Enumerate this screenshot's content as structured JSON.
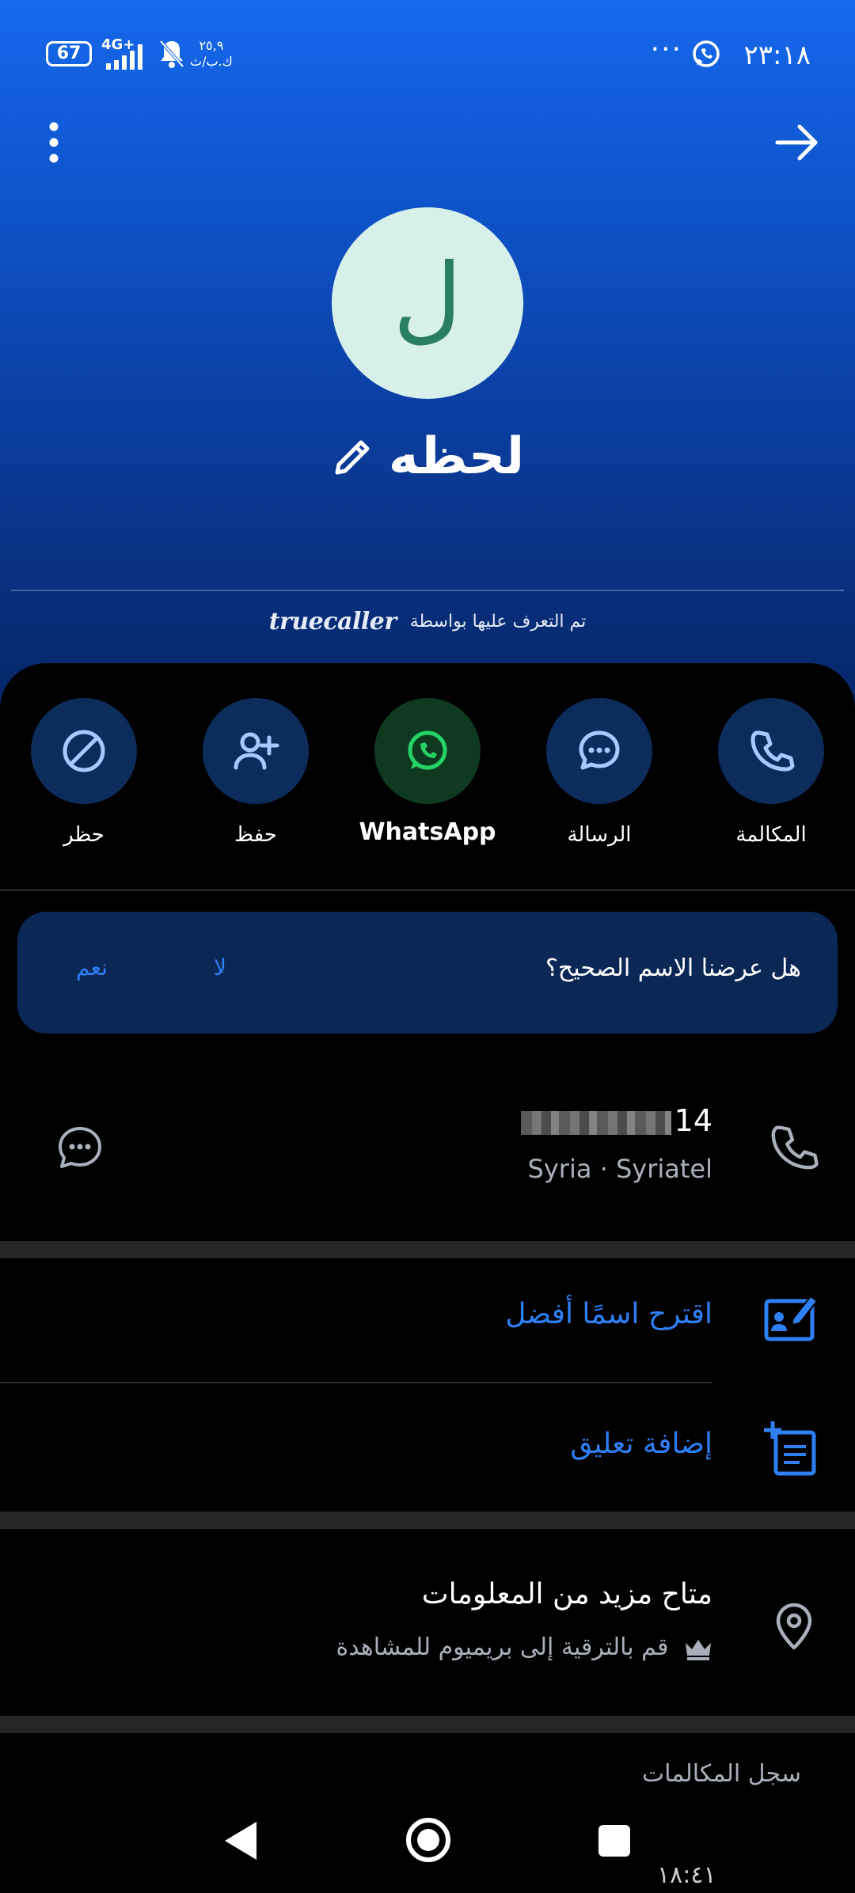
{
  "status_bar": {
    "time": "٢٣:١٨",
    "dots": "···",
    "battery": "67",
    "network": "4G+",
    "speed_value": "٢٥,٩",
    "speed_unit": "ك.ب/ث"
  },
  "contact": {
    "avatar_letter": "ل",
    "name": "لحظه",
    "identified_by": "تم التعرف عليها بواسطة",
    "brand": "truecaller"
  },
  "actions": [
    {
      "label": "المكالمة",
      "icon": "phone-icon"
    },
    {
      "label": "الرسالة",
      "icon": "chat-icon"
    },
    {
      "label": "WhatsApp",
      "icon": "whatsapp-icon"
    },
    {
      "label": "حفظ",
      "icon": "add-person-icon"
    },
    {
      "label": "حظر",
      "icon": "block-icon"
    }
  ],
  "feedback": {
    "question": "هل عرضنا الاسم الصحيح؟",
    "no": "لا",
    "yes": "نعم"
  },
  "phone": {
    "number_suffix": "14",
    "carrier": "Syria · Syriatel"
  },
  "links": {
    "suggest_name": "اقترح اسمًا أفضل",
    "add_comment": "إضافة تعليق"
  },
  "more_info": {
    "title": "متاح مزيد من المعلومات",
    "subtitle": "قم بالترقية إلى بريميوم للمشاهدة"
  },
  "call_log_header": "سجل المكالمات",
  "bottom_peek": "١٨:٤١",
  "colors": {
    "accent_blue": "#2f7ff5",
    "action_circle": "#0c2c5c",
    "whatsapp_circle": "#0f3a1f",
    "whatsapp_green": "#25d366",
    "feedback_card": "#0b2756"
  }
}
